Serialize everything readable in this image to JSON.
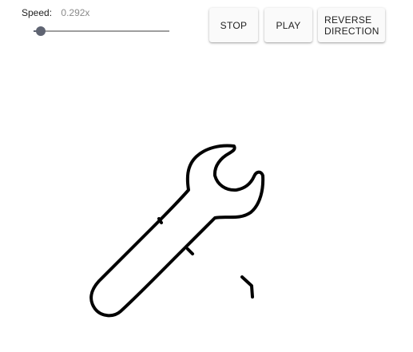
{
  "speed": {
    "label": "Speed:",
    "value_text": "0.292x",
    "level": 0.05
  },
  "buttons": {
    "stop": "STOP",
    "play": "PLAY",
    "reverse": "REVERSE DIRECTION"
  },
  "drawing": {
    "icon": "wrench-icon",
    "stroke_color": "#000000"
  }
}
